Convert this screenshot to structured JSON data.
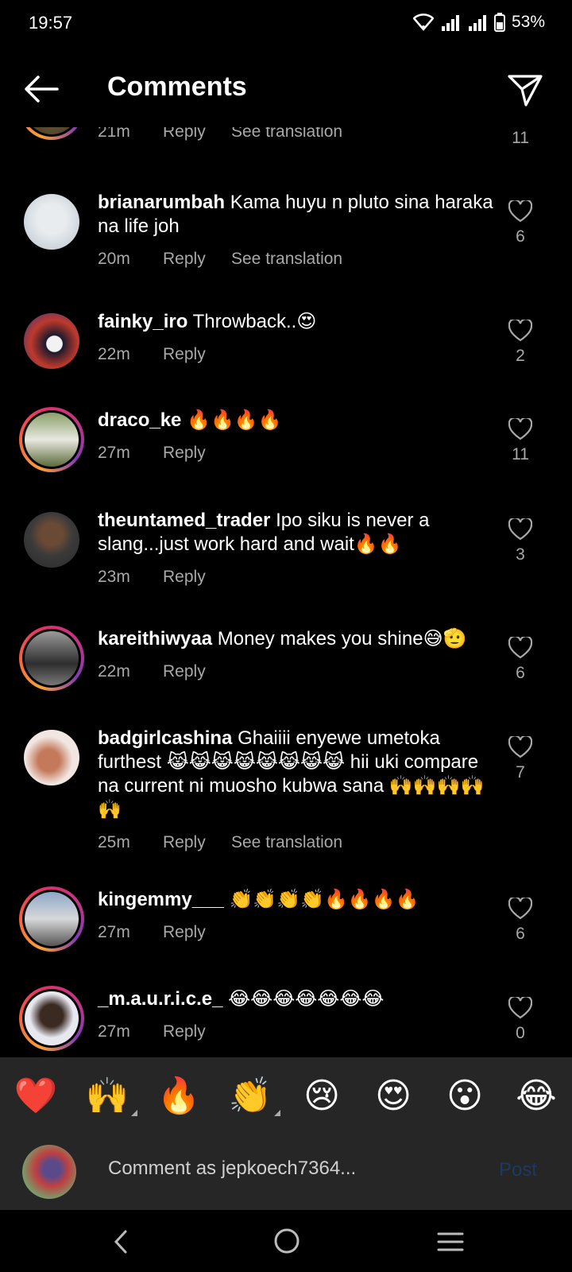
{
  "status": {
    "time": "19:57",
    "battery": "53%"
  },
  "header": {
    "title": "Comments"
  },
  "comments": [
    {
      "user": "",
      "text": "",
      "time": "21m",
      "reply": "Reply",
      "translate": "See translation",
      "likes": "11"
    },
    {
      "user": "brianarumbah",
      "text": "Kama huyu n pluto sina haraka na life joh",
      "time": "20m",
      "reply": "Reply",
      "translate": "See translation",
      "likes": "6"
    },
    {
      "user": "fainky_iro",
      "text": "Throwback..😍",
      "time": "22m",
      "reply": "Reply",
      "likes": "2"
    },
    {
      "user": "draco_ke",
      "text": "🔥🔥🔥🔥",
      "time": "27m",
      "reply": "Reply",
      "likes": "11"
    },
    {
      "user": "theuntamed_trader",
      "text": "Ipo siku is never a slang...just work hard and wait🔥🔥",
      "time": "23m",
      "reply": "Reply",
      "likes": "3"
    },
    {
      "user": "kareithiwyaa",
      "text": "Money makes you shine😅🫡",
      "time": "22m",
      "reply": "Reply",
      "likes": "6"
    },
    {
      "user": "badgirlcashina",
      "text": "Ghaiiii enyewe umetoka furthest 😹😹😹😹😹😹😹😹 hii uki compare na current ni muosho kubwa sana 🙌🙌🙌🙌🙌",
      "time": "25m",
      "reply": "Reply",
      "translate": "See translation",
      "likes": "7"
    },
    {
      "user": "kingemmy___",
      "text": "👏👏👏👏🔥🔥🔥🔥",
      "time": "27m",
      "reply": "Reply",
      "likes": "6"
    },
    {
      "user": "_m.a.u.r.i.c.e_",
      "text": "😂😂😂😂😂😂😂",
      "time": "27m",
      "reply": "Reply",
      "likes": "0"
    }
  ],
  "reactions": [
    "❤️",
    "🙌",
    "🔥",
    "👏",
    "😢",
    "😍",
    "😮",
    "😂"
  ],
  "composer": {
    "placeholder": "Comment as jepkoech7364...",
    "post_label": "Post"
  },
  "colors": {
    "accent": "#0095f6",
    "muted": "#a8a8a8",
    "bar": "#262626"
  }
}
